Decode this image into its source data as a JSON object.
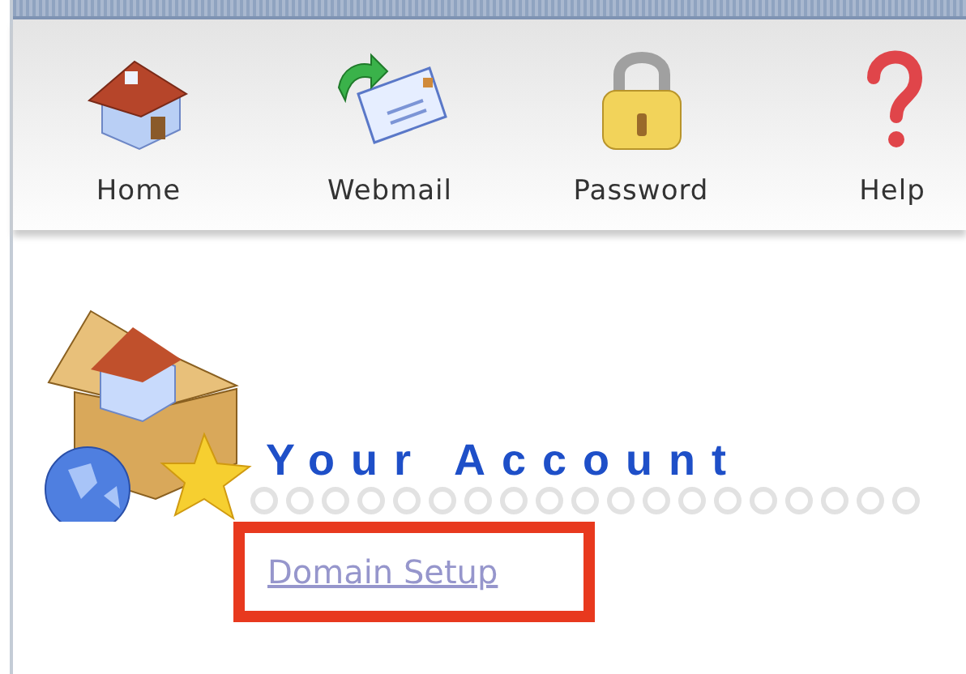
{
  "toolbar": {
    "items": [
      {
        "kind": "home",
        "label": "Home"
      },
      {
        "kind": "mail",
        "label": "Webmail"
      },
      {
        "kind": "lock",
        "label": "Password"
      },
      {
        "kind": "help",
        "label": "Help"
      }
    ]
  },
  "section": {
    "title": "Your Account",
    "link": {
      "label": "Domain Setup",
      "highlighted": true
    }
  }
}
